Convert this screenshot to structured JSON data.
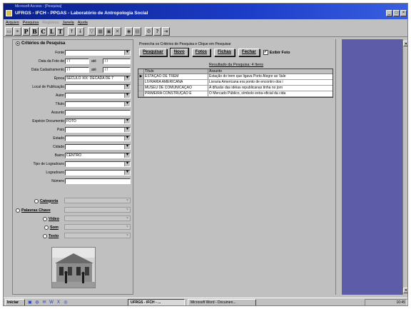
{
  "window": {
    "top_title": "Microsoft Access - [Pesquisa]",
    "title": "UFRGS  -  IFCH  -  PPGAS  -  Laboratório de Antropologia Social"
  },
  "menu": [
    "Arquivo",
    "Pesquisa",
    "Registros",
    "Janela",
    "Ajuda"
  ],
  "toolbar": {
    "letters": [
      "P",
      "B",
      "C",
      "L",
      "T"
    ]
  },
  "left": {
    "section_title": "Critérios de Pesquisa",
    "fields": [
      {
        "label": "Fonte",
        "value": ""
      },
      {
        "label": "Data da Foto de",
        "from": "/ /",
        "ate_label": "até",
        "to": "/ /"
      },
      {
        "label": "Data Cadastramento",
        "from": "/ /",
        "ate_label": "até",
        "to": "/ /"
      },
      {
        "label": "Época",
        "value": "SÉCULO XIX: DÉCADA DE 7"
      },
      {
        "label": "Local de Publicação",
        "value": ""
      },
      {
        "label": "Autor",
        "value": ""
      },
      {
        "label": "Título",
        "value": ""
      },
      {
        "label": "Assunto",
        "value": ""
      },
      {
        "label": "Espécie Documento",
        "value": "FOTO"
      },
      {
        "label": "País",
        "value": ""
      },
      {
        "label": "Estado",
        "value": ""
      },
      {
        "label": "Cidade",
        "value": ""
      },
      {
        "label": "Bairro",
        "value": "CENTRO"
      },
      {
        "label": "Tipo de Logradouro",
        "value": ""
      },
      {
        "label": "Logradouro",
        "value": ""
      },
      {
        "label": "Número",
        "value": ""
      }
    ],
    "options": {
      "categoria": "Categoria",
      "palavras_chave": "Palavras Chave",
      "video": "Vídeo",
      "som": "Som",
      "texto": "Texto"
    }
  },
  "right": {
    "instructions": "Preencha os Critérios de Pesquisa e Clique em Pesquisar",
    "buttons": {
      "pesquisar": "Pesquisar",
      "novo": "Novo",
      "fotos": "Fotos",
      "fichas": "Fichas",
      "fechar": "Fechar",
      "exibir_foto": "Exibir Foto"
    },
    "result_title": "Resultado da Pesquisa:  4  Itens",
    "columns": [
      "Título",
      "Assunto"
    ],
    "rows": [
      {
        "titulo": "ESTAÇÃO DE TREM",
        "assunto": "Estação do trem que ligava Porto Alegre ao Vale"
      },
      {
        "titulo": "LIVRARIA AMERICANA",
        "assunto": "Livraria Americana era ponto de encontro dos i"
      },
      {
        "titulo": "MUSEU DE COMUNICAÇÃO",
        "assunto": "A difusão das idéias republicanas tinha no jorn"
      },
      {
        "titulo": "PRIMEIRA CONSTRUÇÃO E",
        "assunto": "O Mercado Público, símbolo extra-oficial da cida"
      }
    ]
  },
  "taskbar": {
    "start": "Iniciar",
    "tasks": [
      "UFRGS  -  IFCH  - ...",
      "Microsoft Word - Documen..."
    ],
    "clock": "10:45"
  },
  "colors": {
    "titlebar": "#1c3dc8",
    "desktop": "#5c5ca8",
    "face": "#c0c0c0"
  }
}
